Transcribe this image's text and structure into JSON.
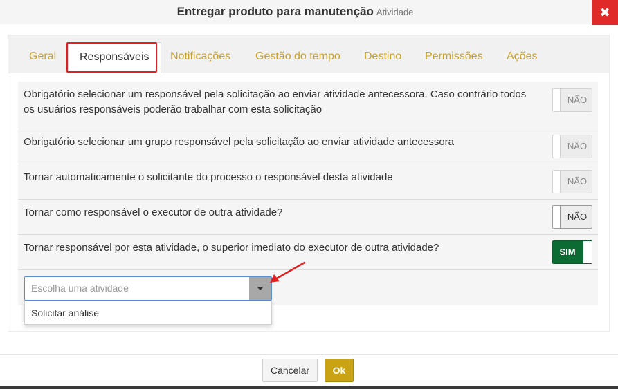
{
  "dialog": {
    "title": "Entregar produto para manutenção",
    "subtitle": "Atividade",
    "close_symbol": "✖"
  },
  "tabs": [
    {
      "label": "Geral",
      "active": false
    },
    {
      "label": "Responsáveis",
      "active": true
    },
    {
      "label": "Notificações",
      "active": false
    },
    {
      "label": "Gestão do tempo",
      "active": false
    },
    {
      "label": "Destino",
      "active": false
    },
    {
      "label": "Permissões",
      "active": false
    },
    {
      "label": "Ações",
      "active": false
    }
  ],
  "settings": [
    {
      "text": "Obrigatório selecionar um responsável pela solicitação ao enviar atividade antecessora. Caso contrário todos os usuários responsáveis poderão trabalhar com esta solicitação",
      "toggle_label": "NÃO",
      "on": false
    },
    {
      "text": "Obrigatório selecionar um grupo responsável pela solicitação ao enviar atividade antecessora",
      "toggle_label": "NÃO",
      "on": false
    },
    {
      "text": "Tornar automaticamente o solicitante do processo o responsável desta atividade",
      "toggle_label": "NÃO",
      "on": false
    },
    {
      "text": "Tornar como responsável o executor de outra atividade?",
      "toggle_label": "NÃO",
      "on": false
    },
    {
      "text": "Tornar responsável por esta atividade, o superior imediato do executor de outra atividade?",
      "toggle_label": "SIM",
      "on": true
    }
  ],
  "activity_select": {
    "placeholder": "Escolha uma atividade",
    "options": [
      "Solicitar análise"
    ]
  },
  "footer": {
    "cancel_label": "Cancelar",
    "ok_label": "Ok"
  },
  "colors": {
    "accent_tab": "#c9a227",
    "close": "#e02a2a",
    "toggle_on": "#0c6b33",
    "ok_button": "#c9a313",
    "annotation": "#e02020"
  }
}
